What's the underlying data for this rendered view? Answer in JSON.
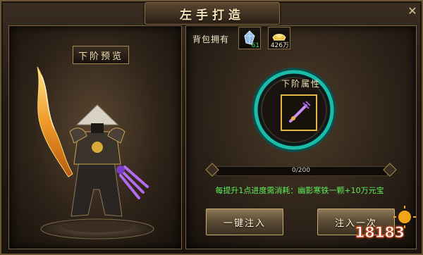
{
  "window": {
    "title": "左手打造",
    "close_glyph": "✕"
  },
  "preview": {
    "label": "下阶预览"
  },
  "bag": {
    "label": "背包拥有",
    "items": [
      {
        "icon": "crystal-icon",
        "count": "61"
      },
      {
        "icon": "gold-ingot-icon",
        "count": "426万"
      }
    ]
  },
  "attributes": {
    "label": "下阶属性",
    "item_icon": "claw-weapon-icon"
  },
  "progress": {
    "text": "0/200",
    "value": 0,
    "max": 200
  },
  "cost_note": "每提升1点进度需消耗：幽影寒铁一颗+10万元宝",
  "buttons": {
    "inject_all": "一键注入",
    "inject_once": "注入一次"
  },
  "watermark": {
    "text": "18183"
  },
  "colors": {
    "accent_gold": "#c7aa72",
    "ring_teal": "#1fd9c2",
    "cost_green": "#5ef05b"
  }
}
